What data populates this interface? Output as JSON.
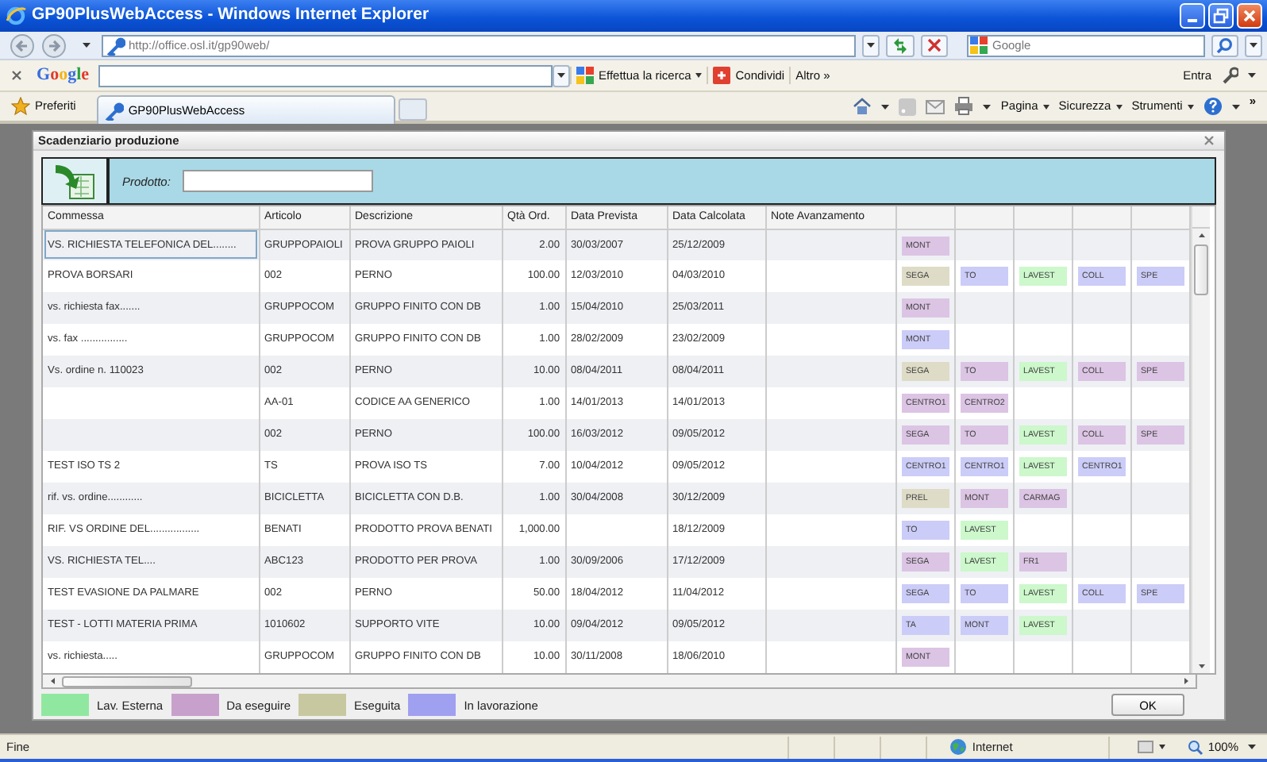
{
  "window": {
    "title": "GP90PlusWebAccess - Windows Internet Explorer"
  },
  "address_bar": {
    "url": "http://office.osl.it/gp90web/",
    "search_placeholder": "Google"
  },
  "google_toolbar": {
    "logo": "Google",
    "buttons": [
      {
        "label": "Effettua la ricerca",
        "kind": "search"
      },
      {
        "label": "Condividi",
        "kind": "share"
      },
      {
        "label": "Altro »",
        "kind": "more"
      }
    ],
    "sign_in": "Entra"
  },
  "favorites_bar": {
    "favorites": "Preferiti",
    "tabs": [
      {
        "label": "GP90PlusWebAccess",
        "selected": true
      }
    ],
    "commands": [
      "Pagina",
      "Sicurezza",
      "Strumenti"
    ],
    "overflow": "»"
  },
  "dialog": {
    "title": "Scadenziario produzione",
    "filter_label": "Prodotto:",
    "columns": [
      "Commessa",
      "Articolo",
      "Descrizione",
      "Qtà Ord.",
      "Data Prevista",
      "Data Calcolata",
      "Note Avanzamento"
    ],
    "rows": [
      {
        "commessa": "VS. RICHIESTA TELEFONICA DEL........",
        "articolo": "GRUPPOPAIOLI",
        "descrizione": "PROVA GRUPPO PAIOLI",
        "qta": "2.00",
        "data_prevista": "30/03/2007",
        "data_calcolata": "25/12/2009",
        "selected": true,
        "stages": [
          {
            "label": "MONT",
            "color": "#dcc4e4"
          }
        ]
      },
      {
        "commessa": "PROVA BORSARI",
        "articolo": "002",
        "descrizione": "PERNO",
        "qta": "100.00",
        "data_prevista": "12/03/2010",
        "data_calcolata": "04/03/2010",
        "selected": false,
        "stages": [
          {
            "label": "SEGA",
            "color": "#dedcc6"
          },
          {
            "label": "TO",
            "color": "#ccccf8"
          },
          {
            "label": "LAVEST",
            "color": "#ccf8cc"
          },
          {
            "label": "COLL",
            "color": "#ccccf8"
          },
          {
            "label": "SPE",
            "color": "#ccccf8"
          }
        ]
      },
      {
        "commessa": "vs. richiesta fax.......",
        "articolo": "GRUPPOCOM",
        "descrizione": "GRUPPO FINITO CON DB",
        "qta": "1.00",
        "data_prevista": "15/04/2010",
        "data_calcolata": "25/03/2011",
        "selected": false,
        "stages": [
          {
            "label": "MONT",
            "color": "#dcc4e4"
          }
        ]
      },
      {
        "commessa": "vs. fax ................",
        "articolo": "GRUPPOCOM",
        "descrizione": "GRUPPO FINITO CON DB",
        "qta": "1.00",
        "data_prevista": "28/02/2009",
        "data_calcolata": "23/02/2009",
        "selected": false,
        "stages": [
          {
            "label": "MONT",
            "color": "#ccccf8"
          }
        ]
      },
      {
        "commessa": "Vs. ordine n. 110023",
        "articolo": "002",
        "descrizione": "PERNO",
        "qta": "10.00",
        "data_prevista": "08/04/2011",
        "data_calcolata": "08/04/2011",
        "selected": false,
        "stages": [
          {
            "label": "SEGA",
            "color": "#dedcc6"
          },
          {
            "label": "TO",
            "color": "#dcc4e4"
          },
          {
            "label": "LAVEST",
            "color": "#ccf8cc"
          },
          {
            "label": "COLL",
            "color": "#dcc4e4"
          },
          {
            "label": "SPE",
            "color": "#dcc4e4"
          }
        ]
      },
      {
        "articolo": "AA-01",
        "descrizione": "CODICE AA GENERICO",
        "qta": "1.00",
        "data_prevista": "14/01/2013",
        "data_calcolata": "14/01/2013",
        "selected": false,
        "stages": [
          {
            "label": "CENTRO1",
            "color": "#dcc4e4"
          },
          {
            "label": "CENTRO2",
            "color": "#dcc4e4"
          }
        ]
      },
      {
        "articolo": "002",
        "descrizione": "PERNO",
        "qta": "100.00",
        "data_prevista": "16/03/2012",
        "data_calcolata": "09/05/2012",
        "selected": false,
        "stages": [
          {
            "label": "SEGA",
            "color": "#dcc4e4"
          },
          {
            "label": "TO",
            "color": "#dcc4e4"
          },
          {
            "label": "LAVEST",
            "color": "#ccf8cc"
          },
          {
            "label": "COLL",
            "color": "#dcc4e4"
          },
          {
            "label": "SPE",
            "color": "#dcc4e4"
          }
        ]
      },
      {
        "commessa": "TEST ISO TS 2",
        "articolo": "TS",
        "descrizione": "PROVA ISO TS",
        "qta": "7.00",
        "data_prevista": "10/04/2012",
        "data_calcolata": "09/05/2012",
        "selected": false,
        "stages": [
          {
            "label": "CENTRO1",
            "color": "#ccccf8"
          },
          {
            "label": "CENTRO1",
            "color": "#ccccf8"
          },
          {
            "label": "LAVEST",
            "color": "#ccf8cc"
          },
          {
            "label": "CENTRO1",
            "color": "#ccccf8"
          }
        ]
      },
      {
        "commessa": "rif. vs. ordine............",
        "articolo": "BICICLETTA",
        "descrizione": "BICICLETTA CON D.B.",
        "qta": "1.00",
        "data_prevista": "30/04/2008",
        "data_calcolata": "30/12/2009",
        "selected": false,
        "stages": [
          {
            "label": "PREL",
            "color": "#dedcc6"
          },
          {
            "label": "MONT",
            "color": "#dcc4e4"
          },
          {
            "label": "CARMAG",
            "color": "#dcc4e4"
          }
        ]
      },
      {
        "commessa": "RIF. VS ORDINE DEL.................",
        "articolo": "BENATI",
        "descrizione": "PRODOTTO PROVA BENATI",
        "qta": "1,000.00",
        "data_calcolata": "18/12/2009",
        "selected": false,
        "stages": [
          {
            "label": "TO",
            "color": "#ccccf8"
          },
          {
            "label": "LAVEST",
            "color": "#ccf8cc"
          }
        ]
      },
      {
        "commessa": "VS. RICHIESTA TEL....",
        "articolo": "ABC123",
        "descrizione": "PRODOTTO PER PROVA",
        "qta": "1.00",
        "data_prevista": "30/09/2006",
        "data_calcolata": "17/12/2009",
        "selected": false,
        "stages": [
          {
            "label": "SEGA",
            "color": "#dcc4e4"
          },
          {
            "label": "LAVEST",
            "color": "#ccf8cc"
          },
          {
            "label": "FR1",
            "color": "#dcc4e4"
          }
        ]
      },
      {
        "commessa": "TEST EVASIONE DA PALMARE",
        "articolo": "002",
        "descrizione": "PERNO",
        "qta": "50.00",
        "data_prevista": "18/04/2012",
        "data_calcolata": "11/04/2012",
        "selected": false,
        "stages": [
          {
            "label": "SEGA",
            "color": "#ccccf8"
          },
          {
            "label": "TO",
            "color": "#ccccf8"
          },
          {
            "label": "LAVEST",
            "color": "#ccf8cc"
          },
          {
            "label": "COLL",
            "color": "#ccccf8"
          },
          {
            "label": "SPE",
            "color": "#ccccf8"
          }
        ]
      },
      {
        "commessa": "TEST - LOTTI MATERIA PRIMA",
        "articolo": "1010602",
        "descrizione": "SUPPORTO VITE",
        "qta": "10.00",
        "data_prevista": "09/04/2012",
        "data_calcolata": "09/05/2012",
        "selected": false,
        "stages": [
          {
            "label": "TA",
            "color": "#ccccf8"
          },
          {
            "label": "MONT",
            "color": "#ccccf8"
          },
          {
            "label": "LAVEST",
            "color": "#ccf8cc"
          }
        ]
      },
      {
        "commessa": "vs. richiesta.....",
        "articolo": "GRUPPOCOM",
        "descrizione": "GRUPPO FINITO CON DB",
        "qta": "10.00",
        "data_prevista": "30/11/2008",
        "data_calcolata": "18/06/2010",
        "selected": false,
        "stages": [
          {
            "label": "MONT",
            "color": "#dcc4e4"
          }
        ]
      }
    ],
    "legend": [
      {
        "label": "Lav. Esterna",
        "color": "#90e8a0"
      },
      {
        "label": "Da eseguire",
        "color": "#c8a0cc"
      },
      {
        "label": "Eseguita",
        "color": "#c8c8a0"
      },
      {
        "label": "In lavorazione",
        "color": "#a0a0f0"
      }
    ],
    "ok_button": "OK"
  },
  "status_bar": {
    "text": "Fine",
    "zone": "Internet",
    "zoom": "100%"
  }
}
